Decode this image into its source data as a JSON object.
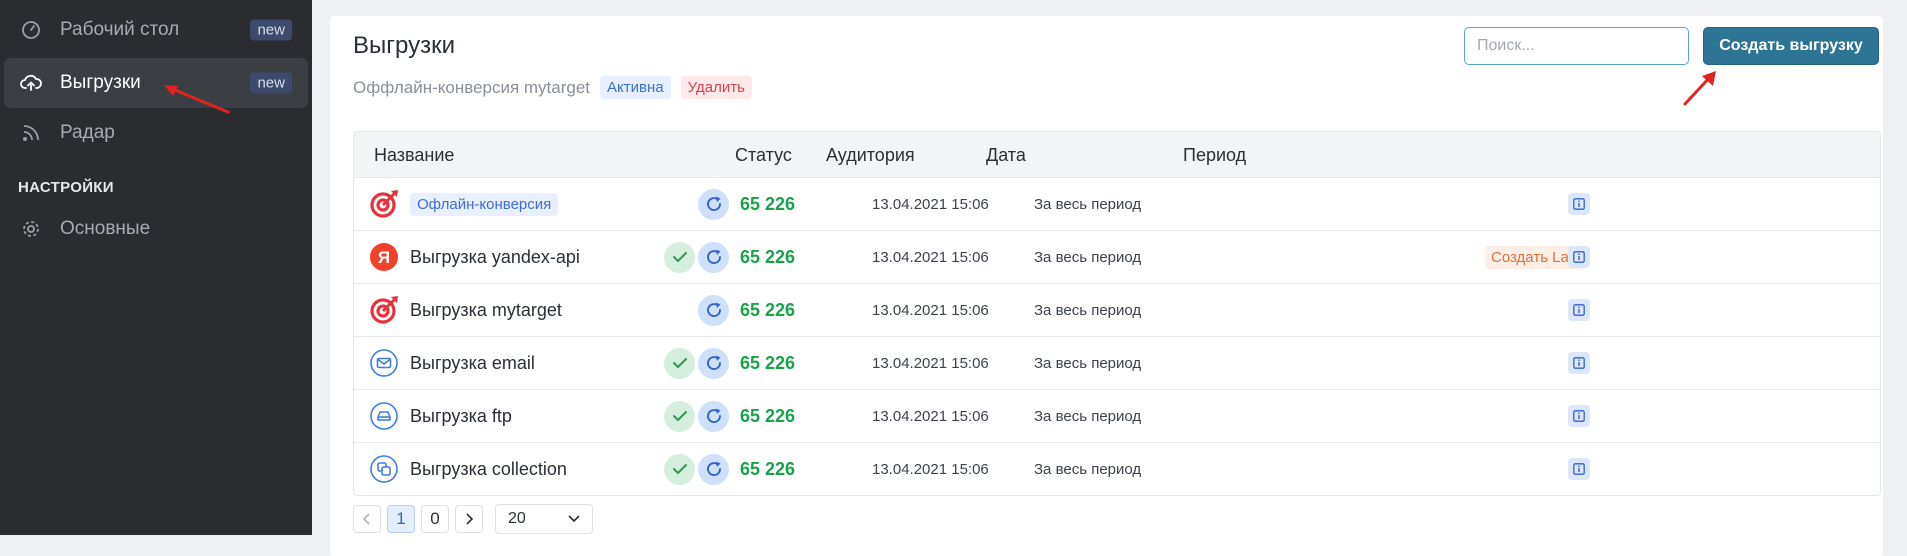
{
  "sidebar": {
    "items": [
      {
        "label": "Рабочий стол",
        "badge": "new",
        "icon": "speedometer-icon"
      },
      {
        "label": "Выгрузки",
        "badge": "new",
        "icon": "cloud-upload-icon"
      },
      {
        "label": "Радар",
        "icon": "rss-icon"
      }
    ],
    "section_title": "НАСТРОЙКИ",
    "settings_items": [
      {
        "label": "Основные",
        "icon": "gear-icon"
      }
    ]
  },
  "header": {
    "title": "Выгрузки",
    "subtitle": "Оффлайн-конверсия mytarget",
    "status_tag": "Активна",
    "delete_tag": "Удалить",
    "search_placeholder": "Поиск...",
    "create_button": "Создать выгрузку"
  },
  "table": {
    "columns": [
      "Название",
      "Статус",
      "Аудитория",
      "Дата",
      "Период"
    ],
    "rows": [
      {
        "name": "Офлайн-конверсия",
        "name_style": "tag",
        "icon": "target-icon",
        "ok": false,
        "audience": "65 226",
        "date": "13.04.2021 15:06",
        "period": "За весь период",
        "lal": ""
      },
      {
        "name": "Выгрузка yandex-api",
        "icon": "yandex-icon",
        "ok": true,
        "audience": "65 226",
        "date": "13.04.2021 15:06",
        "period": "За весь период",
        "lal": "Создать LaL"
      },
      {
        "name": "Выгрузка mytarget",
        "icon": "target-icon",
        "ok": false,
        "audience": "65 226",
        "date": "13.04.2021 15:06",
        "period": "За весь период",
        "lal": ""
      },
      {
        "name": "Выгрузка email",
        "icon": "mail-icon",
        "ok": true,
        "audience": "65 226",
        "date": "13.04.2021 15:06",
        "period": "За весь период",
        "lal": ""
      },
      {
        "name": "Выгрузка ftp",
        "icon": "drive-icon",
        "ok": true,
        "audience": "65 226",
        "date": "13.04.2021 15:06",
        "period": "За весь период",
        "lal": ""
      },
      {
        "name": "Выгрузка collection",
        "icon": "collection-icon",
        "ok": true,
        "audience": "65 226",
        "date": "13.04.2021 15:06",
        "period": "За весь период",
        "lal": ""
      }
    ]
  },
  "pagination": {
    "pages": [
      "1",
      "0"
    ],
    "current": "1",
    "page_size": "20"
  },
  "colors": {
    "accent": "#2e7494",
    "success": "#18a34a",
    "annotation_arrow": "#e02424"
  }
}
